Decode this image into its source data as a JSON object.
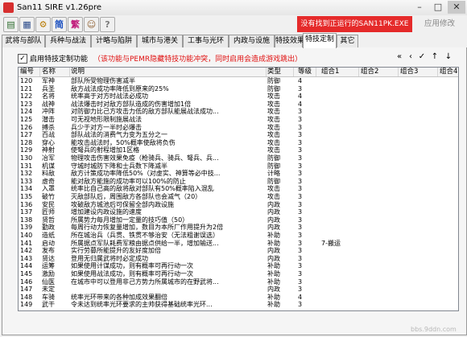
{
  "window": {
    "title": "San11 SIRE v1.26pre"
  },
  "toolbar": {
    "icons": [
      "简",
      "繁"
    ],
    "warning": "没有找到正运行的SAN11PK.EXE",
    "apply_label": "应用修改"
  },
  "tabs": [
    "武将与部队",
    "兵种与战法",
    "计略与陷阱",
    "城市与港关",
    "工事与光环",
    "内政与设施",
    "特技效果",
    "特技定制",
    "其它"
  ],
  "options": {
    "enable_label": "启用特技定制功能",
    "enable_note": "（该功能与PEMR隐藏特技功能冲突，同时启用会造成游戏跳出）"
  },
  "nav_buttons": [
    "«",
    "‹",
    "✓",
    "↑",
    "↓"
  ],
  "table": {
    "headers": [
      "编号",
      "名称",
      "说明",
      "类型",
      "等级",
      "组合1",
      "组合2",
      "组合3",
      "组合4"
    ],
    "rows": [
      [
        "120",
        "军神",
        "部队所受物理伤害减半",
        "防御",
        "4",
        "",
        "",
        "",
        ""
      ],
      [
        "121",
        "兵圣",
        "敌方战法成功率降低到原来的25%",
        "防御",
        "3",
        "",
        "",
        "",
        ""
      ],
      [
        "122",
        "名将",
        "统率高于对方时战法必成功",
        "攻击",
        "4",
        "",
        "",
        "",
        ""
      ],
      [
        "123",
        "战神",
        "战法爆击时对敌方部队造成的伤害增加1倍",
        "攻击",
        "4",
        "",
        "",
        "",
        ""
      ],
      [
        "124",
        "冲阵",
        "对防御力比己方攻击力低的敌方部队能展战法成功...",
        "攻击",
        "3",
        "",
        "",
        "",
        ""
      ],
      [
        "125",
        "潜击",
        "可无视地形限制施展战法",
        "攻击",
        "3",
        "",
        "",
        "",
        ""
      ],
      [
        "126",
        "搏杀",
        "兵少于对方一半时必爆击",
        "攻击",
        "3",
        "",
        "",
        "",
        ""
      ],
      [
        "127",
        "百战",
        "部队战法的消费气力变为五分之一",
        "攻击",
        "3",
        "",
        "",
        "",
        ""
      ],
      [
        "128",
        "穿心",
        "能攻击战法时，50%概率使敌将负伤",
        "攻击",
        "3",
        "",
        "",
        "",
        ""
      ],
      [
        "129",
        "神射",
        "使弩兵的射程增加1区格",
        "攻击",
        "3",
        "",
        "",
        "",
        ""
      ],
      [
        "130",
        "冶军",
        "物理攻击伤害效果免疫（枪骑兵、骑兵、弩兵、兵...",
        "防御",
        "3",
        "",
        "",
        "",
        ""
      ],
      [
        "131",
        "机谋",
        "守城时城防下降和士兵数下降减半",
        "防御",
        "3",
        "",
        "",
        "",
        ""
      ],
      [
        "132",
        "料敌",
        "敌方计策成功率降低50%（对虚实、神算等必中技...",
        "计略",
        "3",
        "",
        "",
        "",
        ""
      ],
      [
        "133",
        "虚奇",
        "能对敌方能施的成功率可以100%的防止",
        "防御",
        "3",
        "",
        "",
        "",
        ""
      ],
      [
        "134",
        "入罩",
        "统率比自己高的敌将敌对部队有50%概率陷入混乱",
        "攻击",
        "3",
        "",
        "",
        "",
        ""
      ],
      [
        "135",
        "破竹",
        "灭敌部队后，周围敌方各部队也会减气（20）",
        "攻击",
        "3",
        "",
        "",
        "",
        ""
      ],
      [
        "136",
        "安民",
        "攻破敌方城池后可保留全部内政设施",
        "内政",
        "3",
        "",
        "",
        "",
        ""
      ],
      [
        "137",
        "匠师",
        "增加建设内政设施的速度",
        "内政",
        "3",
        "",
        "",
        "",
        ""
      ],
      [
        "138",
        "贤哲",
        "所属势力每月增加一定量的技巧值（50）",
        "内政",
        "3",
        "",
        "",
        "",
        ""
      ],
      [
        "139",
        "勤政",
        "每周行动力恢复量增加，数目为本所厂作用提升为2倍",
        "内政",
        "3",
        "",
        "",
        "",
        ""
      ],
      [
        "140",
        "造纸",
        "所在城治兵（兵贯、铁贯不够治安（无法粗谢误选）",
        "补助",
        "3",
        "",
        "",
        "",
        ""
      ],
      [
        "141",
        "启动",
        "所属据点军队耗费军粮由据点供给一半，增加输送...",
        "补助",
        "3",
        "7-搬运",
        "",
        "",
        ""
      ],
      [
        "142",
        "发布",
        "实行劳募所能提升的友好度加倍",
        "内政",
        "3",
        "",
        "",
        "",
        ""
      ],
      [
        "143",
        "贤达",
        "登用无归属武将时必定成功",
        "内政",
        "3",
        "",
        "",
        "",
        ""
      ],
      [
        "144",
        "运筹",
        "如果使用计谋成功，则有概率可再行动一次",
        "补助",
        "3",
        "",
        "",
        "",
        ""
      ],
      [
        "145",
        "激励",
        "如果使用战法成功，则有概率可再行动一次",
        "补助",
        "3",
        "",
        "",
        "",
        ""
      ],
      [
        "146",
        "仙医",
        "在城市中可以登用非己方势力所属城市的在野武将...",
        "补助",
        "3",
        "",
        "",
        "",
        ""
      ],
      [
        "147",
        "未定",
        "",
        "内政",
        "3",
        "",
        "",
        "",
        ""
      ],
      [
        "148",
        "车骑",
        "统率光环带来的各种加成效果翻倍",
        "补助",
        "4",
        "",
        "",
        "",
        ""
      ],
      [
        "149",
        "武干",
        "令未达到统率光环要求的主帅获得基础统率光环...",
        "补助",
        "3",
        "",
        "",
        "",
        ""
      ]
    ]
  }
}
